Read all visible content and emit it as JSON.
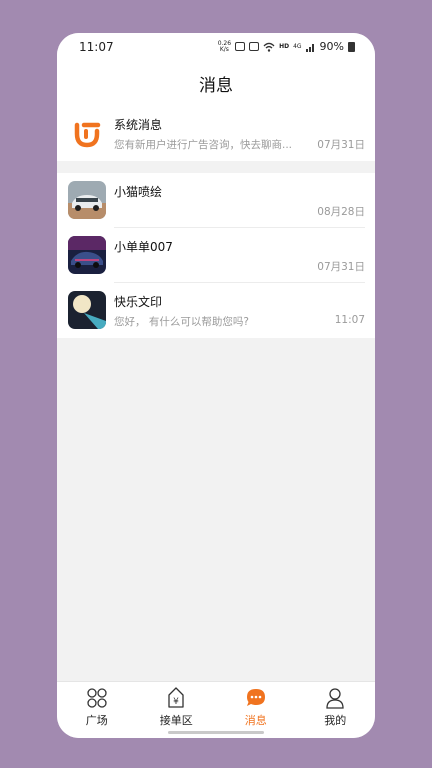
{
  "status_bar": {
    "time": "11:07",
    "speed_top": "0.26",
    "speed_bottom": "K/s",
    "hd": "HD",
    "network": "4G",
    "battery": "90%"
  },
  "header": {
    "title": "消息"
  },
  "system_message": {
    "name": "系统消息",
    "preview": "您有新用户进行广告咨询，快去聊商...",
    "date": "07月31日",
    "icon": "app-logo-icon",
    "accent": "#f0731f"
  },
  "conversations": [
    {
      "name": "小猫喷绘",
      "preview": "",
      "date": "08月28日",
      "avatar": "white-car-avatar"
    },
    {
      "name": "小单单007",
      "preview": "",
      "date": "07月31日",
      "avatar": "neon-car-avatar"
    },
    {
      "name": "快乐文印",
      "preview": "您好， 有什么可以帮助您吗?",
      "date": "11:07",
      "avatar": "moon-avatar"
    }
  ],
  "tabbar": {
    "active": "消息",
    "tabs": [
      {
        "label": "广场",
        "icon": "grid-icon"
      },
      {
        "label": "接单区",
        "icon": "yen-tag-icon"
      },
      {
        "label": "消息",
        "icon": "chat-bubble-icon"
      },
      {
        "label": "我的",
        "icon": "person-icon"
      }
    ]
  }
}
